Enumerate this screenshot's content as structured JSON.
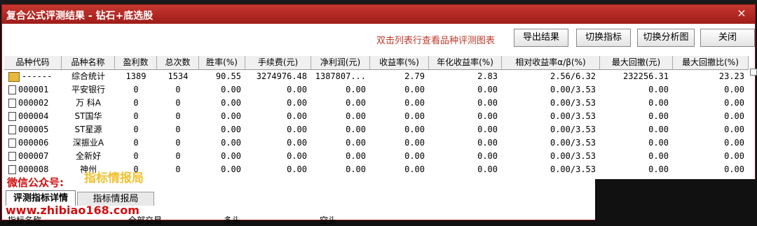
{
  "window": {
    "title": "复合公式评测结果 - 钻石+底选股",
    "close_glyph": "×"
  },
  "hint": "双击列表行查看品种评测图表",
  "buttons": {
    "export": "导出结果",
    "switch_indicator": "切换指标",
    "switch_chart": "切换分析图",
    "close": "关闭"
  },
  "columns": [
    "品种代码",
    "品种名称",
    "盈利数",
    "总次数",
    "胜率(%)",
    "手续费(元)",
    "净利润(元)",
    "收益率(%)",
    "年化收益率(%)",
    "相对收益率α/β(%)",
    "最大回撤(元)",
    "最大回撤比(%)"
  ],
  "rows": [
    {
      "code": "------",
      "name": "综合统计",
      "profit": "1389",
      "total": "1534",
      "win": "90.55",
      "fee": "3274976.48",
      "net": "1387807...",
      "ret": "2.79",
      "annual": "2.83",
      "rel": "2.56/6.32",
      "dd": "232256.31",
      "ddr": "23.23",
      "icon": "folder-icon"
    },
    {
      "code": "000001",
      "name": "平安银行",
      "profit": "0",
      "total": "0",
      "win": "0.00",
      "fee": "0.00",
      "net": "0.00",
      "ret": "0.00",
      "annual": "0.00",
      "rel": "0.00/3.53",
      "dd": "0.00",
      "ddr": "0.00",
      "icon": "document-icon"
    },
    {
      "code": "000002",
      "name": "万 科A",
      "profit": "0",
      "total": "0",
      "win": "0.00",
      "fee": "0.00",
      "net": "0.00",
      "ret": "0.00",
      "annual": "0.00",
      "rel": "0.00/3.53",
      "dd": "0.00",
      "ddr": "0.00",
      "icon": "document-icon"
    },
    {
      "code": "000004",
      "name": "ST国华",
      "profit": "0",
      "total": "0",
      "win": "0.00",
      "fee": "0.00",
      "net": "0.00",
      "ret": "0.00",
      "annual": "0.00",
      "rel": "0.00/3.53",
      "dd": "0.00",
      "ddr": "0.00",
      "icon": "document-icon"
    },
    {
      "code": "000005",
      "name": "ST星源",
      "profit": "0",
      "total": "0",
      "win": "0.00",
      "fee": "0.00",
      "net": "0.00",
      "ret": "0.00",
      "annual": "0.00",
      "rel": "0.00/3.53",
      "dd": "0.00",
      "ddr": "0.00",
      "icon": "document-icon"
    },
    {
      "code": "000006",
      "name": "深振业A",
      "profit": "0",
      "total": "0",
      "win": "0.00",
      "fee": "0.00",
      "net": "0.00",
      "ret": "0.00",
      "annual": "0.00",
      "rel": "0.00/3.53",
      "dd": "0.00",
      "ddr": "0.00",
      "icon": "document-icon"
    },
    {
      "code": "000007",
      "name": "全新好",
      "profit": "0",
      "total": "0",
      "win": "0.00",
      "fee": "0.00",
      "net": "0.00",
      "ret": "0.00",
      "annual": "0.00",
      "rel": "0.00/3.53",
      "dd": "0.00",
      "ddr": "0.00",
      "icon": "document-icon"
    },
    {
      "code": "000008",
      "name": "神州",
      "profit": "0",
      "total": "0",
      "win": "0.00",
      "fee": "0.00",
      "net": "0.00",
      "ret": "0.00",
      "annual": "0.00",
      "rel": "0.00/3.53",
      "dd": "0.00",
      "ddr": "0.00",
      "icon": "document-icon"
    }
  ],
  "tabs": {
    "detail": "评测指标详情",
    "second": "指标情报局"
  },
  "bottom": {
    "indicator_name": "指标名称",
    "all_trades": "全部交易",
    "long": "多头",
    "short": "空头"
  },
  "watermarks": {
    "wechat": "微信公众号:",
    "brand": "指标情报局",
    "url": "www.zhibiao168.com"
  },
  "colors": {
    "title": "#b5241d",
    "hint": "#c0392b",
    "watermark_red": "#d01010",
    "watermark_gold": "#f2c230"
  }
}
